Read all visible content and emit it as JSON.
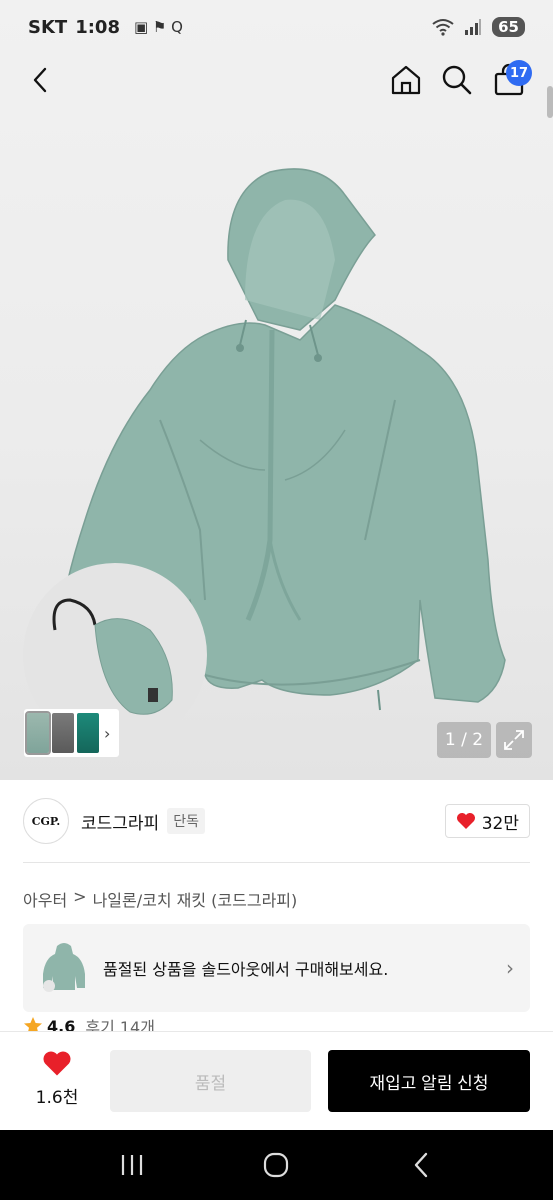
{
  "status_bar": {
    "carrier": "SKT",
    "time": "1:08",
    "extra_icons": "▣ ⚑ Q",
    "battery": "65"
  },
  "nav": {
    "cart_count": "17"
  },
  "gallery": {
    "counter": "1 / 2"
  },
  "brand": {
    "logo_text": "CGP.",
    "name": "코드그라피",
    "tag": "단독",
    "likes": "32만"
  },
  "breadcrumb": {
    "category": "아우터",
    "separator": ">",
    "subcategory": "나일론/코치 재킷 (코드그라피)"
  },
  "soldout_banner": {
    "text": "품절된 상품을 솔드아웃에서 구매해보세요."
  },
  "rating": {
    "score": "4.6",
    "reviews": "후기 14개"
  },
  "buy_bar": {
    "wish_count": "1.6천",
    "soldout_label": "품절",
    "restock_label": "재입고 알림 신청"
  },
  "colors": {
    "accent_blue": "#2f6bf2",
    "like_red": "#e8202a",
    "jacket_mint": "#8fb5aa"
  }
}
